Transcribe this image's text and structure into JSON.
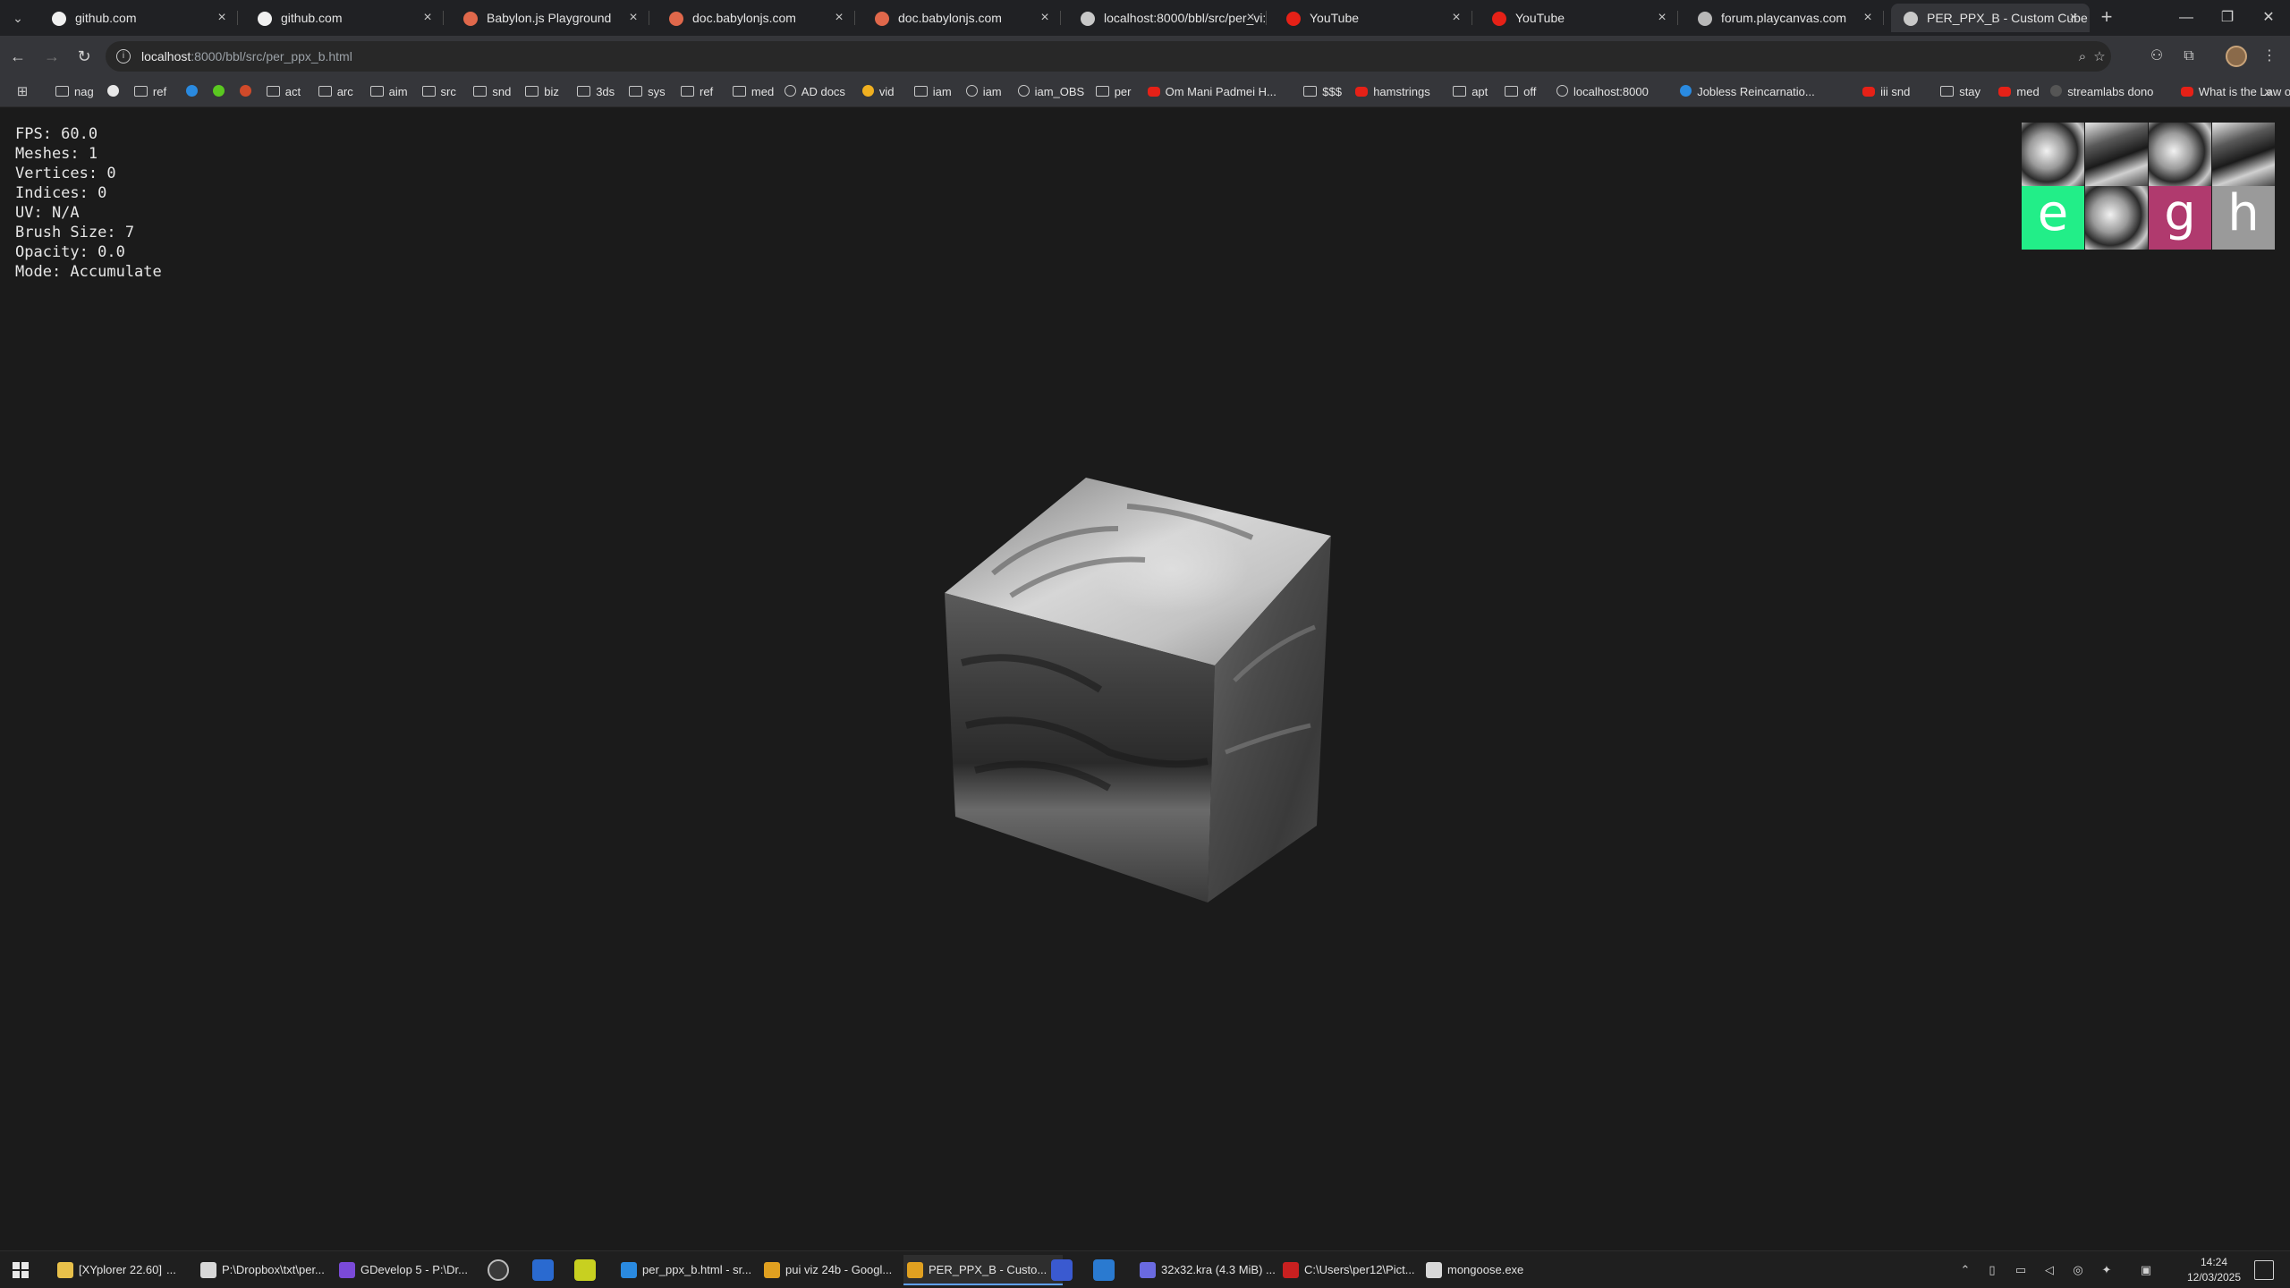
{
  "browser": {
    "tabs": [
      {
        "title": "github.com",
        "favicon": "github-icon",
        "color": "#f0f0f0"
      },
      {
        "title": "github.com",
        "favicon": "github-icon",
        "color": "#f0f0f0"
      },
      {
        "title": "Babylon.js Playground",
        "favicon": "babylon-icon",
        "color": "#e0684b"
      },
      {
        "title": "doc.babylonjs.com",
        "favicon": "babylon-icon",
        "color": "#e0684b"
      },
      {
        "title": "doc.babylonjs.com",
        "favicon": "babylon-icon",
        "color": "#e0684b"
      },
      {
        "title": "localhost:8000/bbl/src/per_vi:",
        "favicon": "globe-icon",
        "color": "#c8c8c8"
      },
      {
        "title": "YouTube",
        "favicon": "youtube-icon",
        "color": "#e62117"
      },
      {
        "title": "YouTube",
        "favicon": "youtube-icon",
        "color": "#e62117"
      },
      {
        "title": "forum.playcanvas.com",
        "favicon": "playcanvas-icon",
        "color": "#b8b8b8"
      },
      {
        "title": "PER_PPX_B - Custom Cube wi",
        "favicon": "globe-icon",
        "color": "#c8c8c8"
      }
    ],
    "active_tab_index": 9,
    "url_host": "localhost",
    "url_rest": ":8000/bbl/src/per_ppx_b.html",
    "bookmarks": [
      {
        "label": "nag",
        "icon": "folder"
      },
      {
        "label": "",
        "icon": "chrome"
      },
      {
        "label": "ref",
        "icon": "folder"
      },
      {
        "label": "",
        "icon": "blue"
      },
      {
        "label": "",
        "icon": "green"
      },
      {
        "label": "",
        "icon": "red"
      },
      {
        "label": "act",
        "icon": "folder"
      },
      {
        "label": "arc",
        "icon": "folder"
      },
      {
        "label": "aim",
        "icon": "folder"
      },
      {
        "label": "src",
        "icon": "folder"
      },
      {
        "label": "snd",
        "icon": "folder"
      },
      {
        "label": "biz",
        "icon": "folder"
      },
      {
        "label": "3ds",
        "icon": "folder"
      },
      {
        "label": "sys",
        "icon": "folder"
      },
      {
        "label": "ref",
        "icon": "folder"
      },
      {
        "label": "med",
        "icon": "folder"
      },
      {
        "label": "AD docs",
        "icon": "globe"
      },
      {
        "label": "vid",
        "icon": "dot"
      },
      {
        "label": "iam",
        "icon": "folder"
      },
      {
        "label": "iam",
        "icon": "globe"
      },
      {
        "label": "iam_OBS",
        "icon": "globe"
      },
      {
        "label": "per",
        "icon": "folder"
      },
      {
        "label": "Om Mani Padmei H...",
        "icon": "yt"
      },
      {
        "label": "$$$",
        "icon": "folder"
      },
      {
        "label": "hamstrings",
        "icon": "yt"
      },
      {
        "label": "apt",
        "icon": "folder"
      },
      {
        "label": "off",
        "icon": "folder"
      },
      {
        "label": "localhost:8000",
        "icon": "globe"
      },
      {
        "label": "Jobless Reincarnatio...",
        "icon": "blue"
      },
      {
        "label": "iii snd",
        "icon": "yt"
      },
      {
        "label": "stay",
        "icon": "folder"
      },
      {
        "label": "med",
        "icon": "yt"
      },
      {
        "label": "streamlabs dono",
        "icon": "dark"
      },
      {
        "label": "What is the Law of...",
        "icon": "yt"
      }
    ]
  },
  "stats": {
    "fps": "FPS: 60.0",
    "meshes": "Meshes: 1",
    "vertices": "Vertices: 0",
    "indices": "Indices: 0",
    "uv": "UV: N/A",
    "brush_size": "Brush Size: 7",
    "opacity": "Opacity: 0.0",
    "mode": "Mode: Accumulate"
  },
  "atlas": {
    "letters": [
      {
        "char": "e",
        "color": "#22ee88"
      },
      {
        "char": "",
        "color": "#d8d8d8"
      },
      {
        "char": "g",
        "color": "#b03a6e"
      },
      {
        "char": "h",
        "color": "#9a9a9a"
      }
    ]
  },
  "taskbar": {
    "items": [
      {
        "label": "[XYplorer 22.60]",
        "color": "#e8c04a"
      },
      {
        "label": "...",
        "color": ""
      },
      {
        "label": "P:\\Dropbox\\txt\\per...",
        "color": "#d8d8d8"
      },
      {
        "label": "GDevelop 5 - P:\\Dr...",
        "color": "#7a4ad8"
      },
      {
        "label": "per_ppx_b.html - sr...",
        "color": "#2a8ae0"
      },
      {
        "label": "pui viz 24b - Googl...",
        "color": "#e0a020"
      },
      {
        "label": "PER_PPX_B - Custo...",
        "color": "#e0a020"
      },
      {
        "label": "32x32.kra (4.3 MiB) ...",
        "color": "#6a6ae0"
      },
      {
        "label": "C:\\Users\\per12\\Pict...",
        "color": "#c82020"
      },
      {
        "label": "mongoose.exe",
        "color": "#d8d8d8"
      }
    ],
    "time": "14:24",
    "date": "12/03/2025"
  }
}
